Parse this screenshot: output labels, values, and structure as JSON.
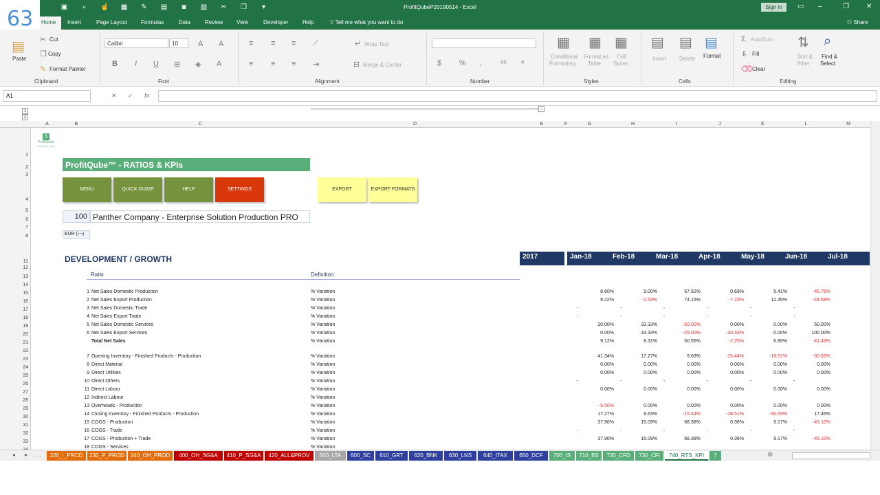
{
  "badge": "63",
  "window": {
    "title": "ProfitQubeP20190514 - Excel",
    "signin": "Sign in",
    "share": "Share"
  },
  "tabs": [
    "Home",
    "Insert",
    "Page Layout",
    "Formulas",
    "Data",
    "Review",
    "View",
    "Developer",
    "Help"
  ],
  "tellme": "Tell me what you want to do",
  "ribbon": {
    "clipboard": {
      "label": "Clipboard",
      "paste": "Paste",
      "cut": "Cut",
      "copy": "Copy",
      "format_painter": "Format Painter"
    },
    "font": {
      "label": "Font",
      "name": "Calibri",
      "size": "10"
    },
    "alignment": {
      "label": "Alignment",
      "wrap": "Wrap Text",
      "merge": "Merge & Center"
    },
    "number": {
      "label": "Number"
    },
    "styles": {
      "label": "Styles",
      "cond": "Conditional",
      "cond2": "Formatting",
      "fmt_table": "Format as",
      "fmt_table2": "Table",
      "cell_styles": "Cell",
      "cell_styles2": "Styles"
    },
    "cells": {
      "label": "Cells",
      "insert": "Insert",
      "delete": "Delete",
      "format": "Format"
    },
    "editing": {
      "label": "Editing",
      "autosum": "AutoSum",
      "fill": "Fill",
      "clear": "Clear",
      "sort": "Sort &",
      "sort2": "Filter",
      "find": "Find &",
      "find2": "Select"
    }
  },
  "namebox": "A1",
  "columns": [
    "A",
    "B",
    "C",
    "D",
    "E",
    "F",
    "G",
    "H",
    "I",
    "J",
    "K",
    "L",
    "M"
  ],
  "outline_levels": [
    "1",
    "2",
    "3"
  ],
  "rows": [
    "1",
    "2",
    "3",
    "4",
    "5",
    "6",
    "7",
    "8",
    "11",
    "12",
    "13",
    "14",
    "15",
    "16",
    "17",
    "18",
    "19",
    "20",
    "21",
    "22",
    "23",
    "24",
    "25",
    "26",
    "27",
    "28",
    "29",
    "30",
    "31",
    "32",
    "33",
    "34"
  ],
  "logo": {
    "name": "ProfitQube",
    "tagline": "Made by Phas"
  },
  "banner": "ProfitQube™ - RATIOS & KPIs",
  "buttons": {
    "menu": "MENU",
    "quick": "QUICK GUIDE",
    "help": "HELP",
    "settings": "SETTINGS",
    "export": "EXPORT",
    "export_formats": "EXPORT FORMATS"
  },
  "company": {
    "code": "100",
    "name": "Panther Company - Enterprise Solution Production PRO",
    "currency": "EUR (---)"
  },
  "section_title": "DEVELOPMENT / GROWTH",
  "month_headers": [
    "2017",
    "Jan-18",
    "Feb-18",
    "Mar-18",
    "Apr-18",
    "May-18",
    "Jun-18",
    "Jul-18"
  ],
  "col_labels": {
    "ratio": "Ratio",
    "definition": "Definition"
  },
  "table_rows": [
    {
      "n": "1",
      "ratio": "Net Sales Domestic Production",
      "def": "% Variation",
      "v": [
        "8.60%",
        "9.00%",
        "57.52%",
        "0.69%",
        "5.41%",
        "-45.76%"
      ]
    },
    {
      "n": "2",
      "ratio": "Net Sales Export Production",
      "def": "% Variation",
      "v": [
        "9.22%",
        "-1.53%",
        "74.15%",
        "-7.15%",
        "11.35%",
        "-44.68%"
      ]
    },
    {
      "n": "3",
      "ratio": "Net Sales Domestic Trade",
      "def": "% Variation",
      "v": [
        "-",
        "-",
        "-",
        "-",
        "-",
        "-"
      ]
    },
    {
      "n": "4",
      "ratio": "Net Sales Export Trade",
      "def": "% Variation",
      "v": [
        "-",
        "-",
        "-",
        "-",
        "-",
        "-"
      ]
    },
    {
      "n": "5",
      "ratio": "Net Sales Domestic Services",
      "def": "% Variation",
      "v": [
        "20.00%",
        "33.33%",
        "-50.00%",
        "0.00%",
        "0.00%",
        "50.00%"
      ]
    },
    {
      "n": "6",
      "ratio": "Net Sales Export Services",
      "def": "% Variation",
      "v": [
        "0.00%",
        "33.33%",
        "-25.00%",
        "-33.33%",
        "0.00%",
        "100.00%"
      ]
    },
    {
      "n": "",
      "ratio": "Total Net Sales",
      "def": "% Variation",
      "v": [
        "9.12%",
        "8.31%",
        "50.55%",
        "-2.25%",
        "6.85%",
        "-41.43%"
      ]
    },
    {
      "n": "",
      "ratio": "",
      "def": "",
      "v": [
        "",
        "",
        "",
        "",
        "",
        ""
      ]
    },
    {
      "n": "7",
      "ratio": "Opening Inventory - Finished Products - Production",
      "def": "% Variation",
      "v": [
        "41.34%",
        "17.27%",
        "9.63%",
        "-15.44%",
        "-18.51%",
        "-30.69%"
      ]
    },
    {
      "n": "8",
      "ratio": "Direct Material",
      "def": "% Variation",
      "v": [
        "0.00%",
        "0.00%",
        "0.00%",
        "0.00%",
        "0.00%",
        "0.00%"
      ]
    },
    {
      "n": "9",
      "ratio": "Direct Utilities",
      "def": "% Variation",
      "v": [
        "0.00%",
        "0.00%",
        "0.00%",
        "0.00%",
        "0.00%",
        "0.00%"
      ]
    },
    {
      "n": "10",
      "ratio": "Direct Others",
      "def": "% Variation",
      "v": [
        "-",
        "-",
        "-",
        "-",
        "-",
        "-"
      ]
    },
    {
      "n": "11",
      "ratio": "Direct Labour",
      "def": "% Variation",
      "v": [
        "0.00%",
        "0.00%",
        "0.00%",
        "0.00%",
        "0.00%",
        "0.00%"
      ]
    },
    {
      "n": "12",
      "ratio": "Indirect Labour",
      "def": "% Variation",
      "v": [
        "",
        "",
        "",
        "",
        "",
        ""
      ]
    },
    {
      "n": "13",
      "ratio": "Overheads - Production",
      "def": "% Variation",
      "v": [
        "-5.50%",
        "0.00%",
        "0.00%",
        "0.00%",
        "0.00%",
        "0.00%"
      ]
    },
    {
      "n": "14",
      "ratio": "Closing Inventory - Finished Products - Production",
      "def": "% Variation",
      "v": [
        "17.27%",
        "9.63%",
        "-15.44%",
        "-18.51%",
        "-30.69%",
        "17.46%"
      ]
    },
    {
      "n": "15",
      "ratio": "COGS - Production",
      "def": "% Variation",
      "v": [
        "37.90%",
        "15.09%",
        "68.38%",
        "0.36%",
        "9.17%",
        "-45.10%"
      ]
    },
    {
      "n": "16",
      "ratio": "COGS - Trade",
      "def": "% Variation",
      "v": [
        "-",
        "-",
        "-",
        "-",
        "-",
        "-"
      ]
    },
    {
      "n": "17",
      "ratio": "COGS - Production + Trade",
      "def": "% Variation",
      "v": [
        "37.90%",
        "15.09%",
        "68.38%",
        "0.36%",
        "9.17%",
        "-45.10%"
      ]
    },
    {
      "n": "18",
      "ratio": "COGS - Services",
      "def": "% Variation",
      "v": [
        "",
        "",
        "",
        "",
        "",
        ""
      ]
    }
  ],
  "sheet_tabs": [
    {
      "name": "220_I_PROD",
      "color": "#e36c0a"
    },
    {
      "name": "230_P_PROD",
      "color": "#e36c0a"
    },
    {
      "name": "240_OH_PROD",
      "color": "#e36c0a"
    },
    {
      "name": "400_OH_SG&A",
      "color": "#c00000"
    },
    {
      "name": "410_P_SG&A",
      "color": "#c00000"
    },
    {
      "name": "420_ALL&PROV",
      "color": "#c00000"
    },
    {
      "name": "500_LTA",
      "color": "#a6a6a6"
    },
    {
      "name": "600_SC",
      "color": "#2f3f9e"
    },
    {
      "name": "610_GRT",
      "color": "#2f3f9e"
    },
    {
      "name": "620_BNK",
      "color": "#2f3f9e"
    },
    {
      "name": "630_LNS",
      "color": "#2f3f9e"
    },
    {
      "name": "640_ITAX",
      "color": "#2f3f9e"
    },
    {
      "name": "650_DCF",
      "color": "#2f3f9e"
    },
    {
      "name": "700_IS",
      "color": "#5aae7a"
    },
    {
      "name": "710_BS",
      "color": "#5aae7a"
    },
    {
      "name": "720_CFD",
      "color": "#5aae7a"
    },
    {
      "name": "730_CFI",
      "color": "#5aae7a"
    },
    {
      "name": "740_RTS_KPI",
      "color": "#ffffff"
    },
    {
      "name": "7",
      "color": "#5aae7a"
    }
  ]
}
